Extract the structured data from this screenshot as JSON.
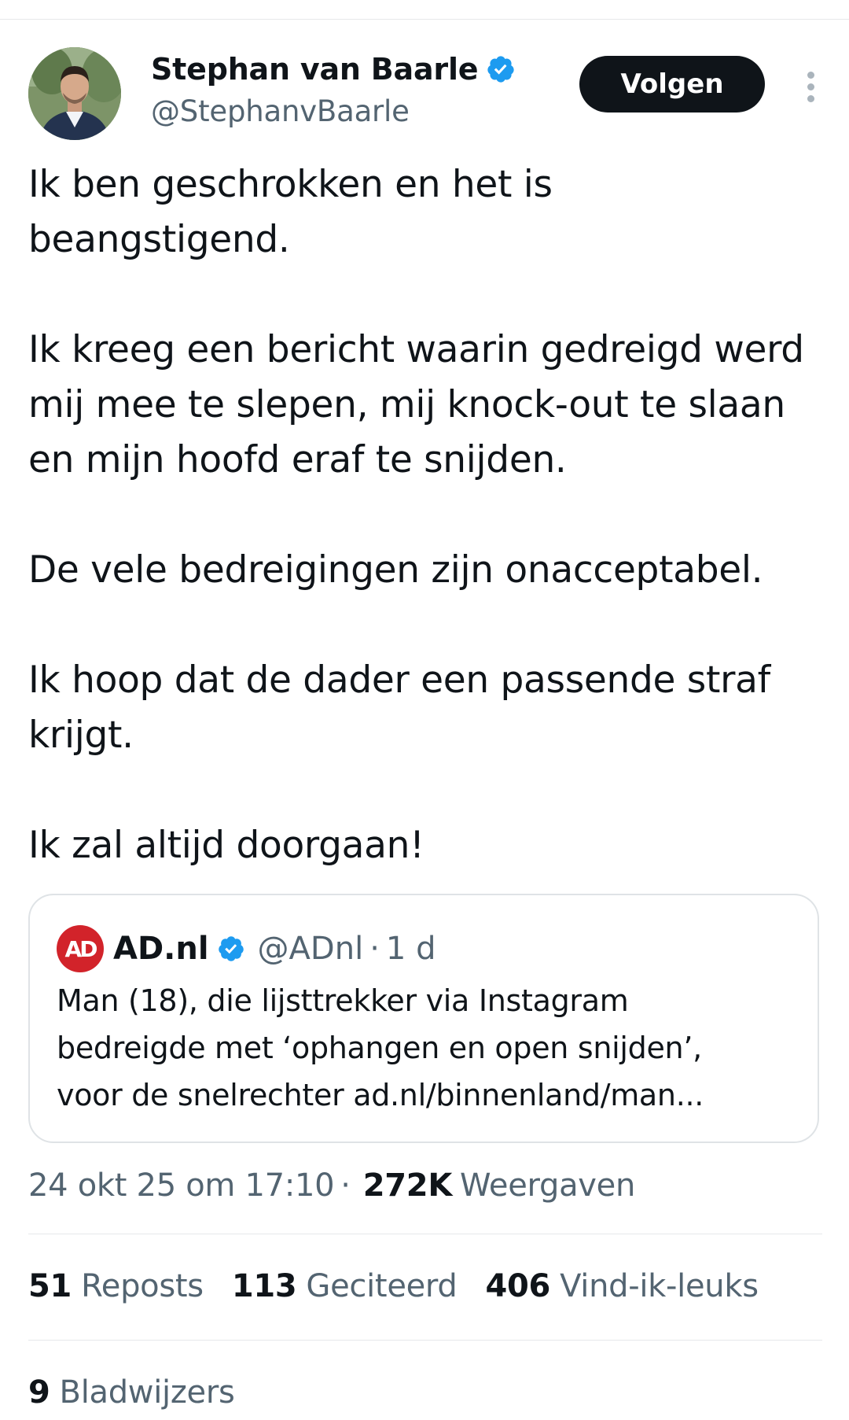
{
  "author": {
    "display_name": "Stephan van Baarle",
    "handle": "@StephanvBaarle",
    "verified": true
  },
  "follow_button": {
    "label": "Volgen"
  },
  "more_button": {
    "icon": "more-vertical-icon"
  },
  "tweet": {
    "paragraphs": [
      "Ik ben geschrokken en het is beangstigend.",
      "Ik kreeg een bericht waarin gedreigd werd mij mee te slepen, mij knock-out te slaan en mijn hoofd eraf te snijden.",
      "De vele bedreigingen zijn onacceptabel.",
      "Ik hoop dat de dader een passende straf krijgt.",
      "Ik zal altijd doorgaan!"
    ]
  },
  "quote": {
    "logo_text": "AD",
    "display_name": "AD.nl",
    "verified": true,
    "handle": "@ADnl",
    "separator": "·",
    "time": "1 d",
    "text_lines": [
      "Man (18), die lijsttrekker via Instagram",
      "bedreigde met ‘ophangen en open snijden’,",
      "voor de snelrechter ad.nl/binnenland/man..."
    ]
  },
  "meta": {
    "timestamp": "24 okt 25 om 17:10",
    "separator": "·",
    "views_count": "272K",
    "views_label": "Weergaven"
  },
  "stats": {
    "reposts": {
      "count": "51",
      "label": "Reposts"
    },
    "quotes": {
      "count": "113",
      "label": "Geciteerd"
    },
    "likes": {
      "count": "406",
      "label": "Vind-ik-leuks"
    },
    "bookmarks": {
      "count": "9",
      "label": "Bladwijzers"
    }
  },
  "colors": {
    "verified_blue": "#1d9bf0",
    "ad_red": "#d2232a",
    "secondary_text": "#536471",
    "primary_text": "#0f1419"
  }
}
